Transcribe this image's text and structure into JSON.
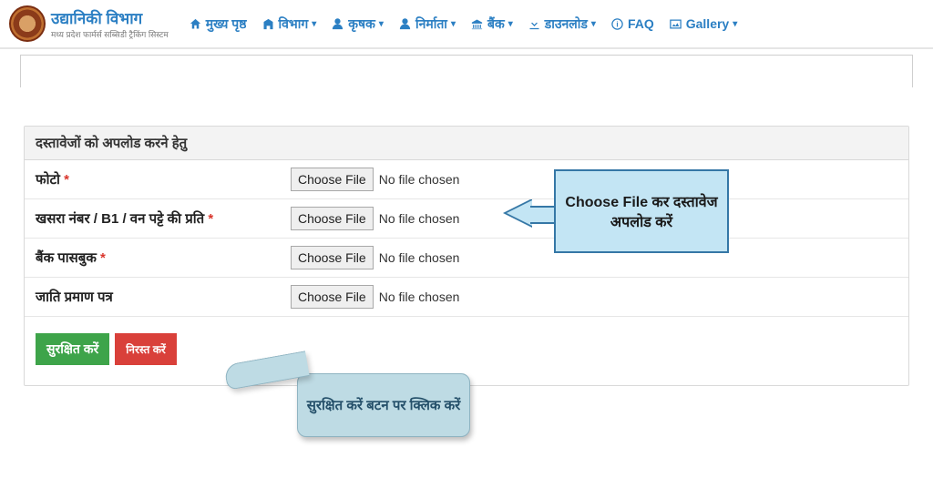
{
  "brand": {
    "title": "उद्यानिकी विभाग",
    "subtitle": "मध्य प्रदेश फार्मर्स सब्सिडी ट्रैकिंग सिस्टम"
  },
  "nav": {
    "home": "मुख्य पृष्ठ",
    "dept": "विभाग",
    "farmer": "कृषक",
    "maker": "निर्माता",
    "bank": "बैंक",
    "download": "डाउनलोड",
    "faq": "FAQ",
    "gallery": "Gallery"
  },
  "panel": {
    "title": "दस्तावेजों को अपलोड करने हेतु"
  },
  "rows": {
    "photo": {
      "label": "फोटो",
      "required": true,
      "btn": "Choose File",
      "status": "No file chosen"
    },
    "khasra": {
      "label": "खसरा नंबर / B1 / वन पट्टे की प्रति",
      "required": true,
      "btn": "Choose File",
      "status": "No file chosen"
    },
    "passbook": {
      "label": "बैंक पासबुक",
      "required": true,
      "btn": "Choose File",
      "status": "No file chosen"
    },
    "caste": {
      "label": "जाति प्रमाण पत्र",
      "required": false,
      "btn": "Choose File",
      "status": "No file chosen"
    }
  },
  "buttons": {
    "save": "सुरक्षित करें",
    "cancel": "निरस्त करें"
  },
  "callouts": {
    "upload": "Choose File कर दस्तावेज अपलोड करें",
    "save": "सुरक्षित करें बटन पर क्लिक करें"
  },
  "required_mark": " *"
}
